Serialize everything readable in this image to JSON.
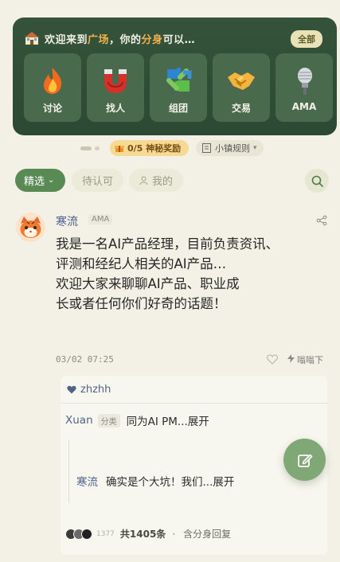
{
  "banner": {
    "welcome_prefix": "欢迎来到",
    "welcome_place": "广场",
    "welcome_mid": "，你的",
    "welcome_self": "分身",
    "welcome_suffix": "可以…",
    "all_label": "全部",
    "tiles": [
      {
        "label": "讨论",
        "icon": "fire-icon"
      },
      {
        "label": "找人",
        "icon": "magnet-icon"
      },
      {
        "label": "组团",
        "icon": "puzzle-icon"
      },
      {
        "label": "交易",
        "icon": "handshake-icon"
      },
      {
        "label": "AMA",
        "icon": "microphone-icon"
      }
    ]
  },
  "pager": {
    "reward_label": "0/5 神秘奖励",
    "rules_label": "小镇规则",
    "rules_chevron": "▾"
  },
  "filters": {
    "selected": "精选",
    "selected_chevron": "⌄",
    "pending": "待认可",
    "mine": "我的"
  },
  "post": {
    "author": "寒流",
    "tag": "AMA",
    "body": "我是一名AI产品经理，目前负责资讯、\n评测和经纪人相关的AI产品…\n欢迎大家来聊聊AI产品、职业成\n长或者任何你们好奇的话题！",
    "time": "03/02 07:25",
    "zhihu_label": "嗡嗡下"
  },
  "comments": {
    "liker": "zhzhh",
    "first": {
      "name": "Xuan",
      "badge": "分类",
      "text": "同为AI PM...展开"
    },
    "reply": {
      "name": "寒流",
      "text": "确实是个大坑！我们...展开"
    },
    "footer_small": "1377",
    "footer_total": "共1405条",
    "footer_sep": "·",
    "footer_note": "含分身回复"
  },
  "colors": {
    "banner_bg": "#2e4d35",
    "accent_green": "#5a8a54",
    "fab_green": "#80a876",
    "link_blue": "#4f6389",
    "highlight_orange": "#f3b14c"
  }
}
